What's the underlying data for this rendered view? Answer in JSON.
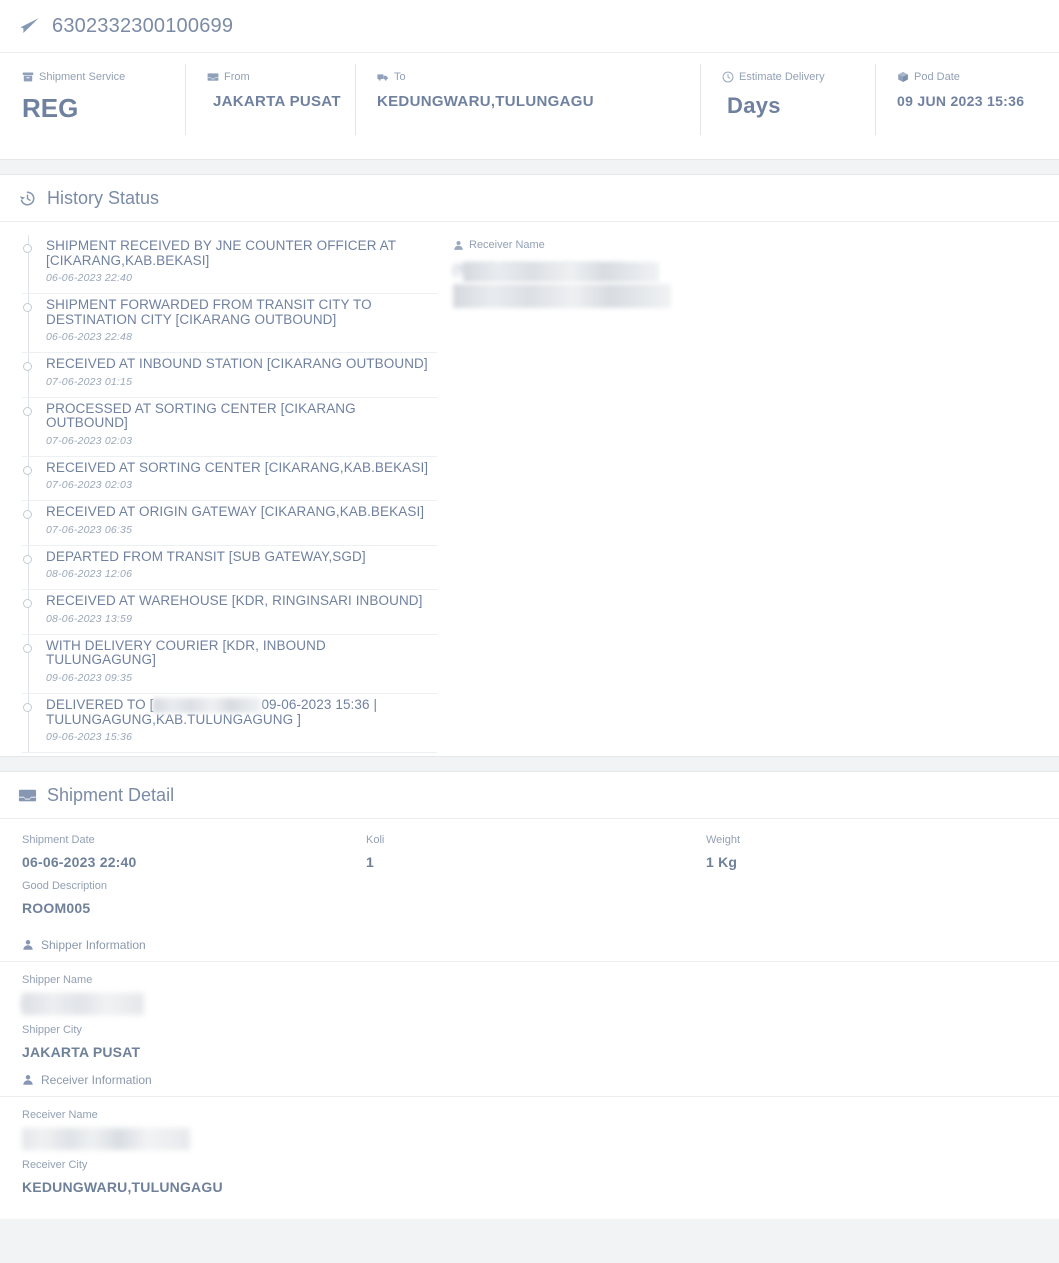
{
  "header": {
    "awb_number": "6302332300100699",
    "plane_icon": "paper-plane-icon",
    "fields": [
      {
        "key": "service",
        "icon": "archive-box-icon",
        "label": "Shipment Service",
        "value": "REG"
      },
      {
        "key": "from",
        "icon": "inbox-tray-icon",
        "label": "From",
        "value": "JAKARTA  PUSAT"
      },
      {
        "key": "to",
        "icon": "truck-icon",
        "label": "To",
        "value": "KEDUNGWARU,TULUNGAGU"
      },
      {
        "key": "eta",
        "icon": "clock-icon",
        "label": "Estimate Delivery",
        "value": "Days"
      },
      {
        "key": "pod",
        "icon": "cube-icon",
        "label": "Pod Date",
        "value": "09 JUN 2023  15:36"
      }
    ]
  },
  "history": {
    "icon": "history-clock-icon",
    "title": "History Status",
    "items": [
      {
        "text": "SHIPMENT RECEIVED BY JNE COUNTER OFFICER AT [CIKARANG,KAB.BEKASI]",
        "time": "06-06-2023 22:40"
      },
      {
        "text": "SHIPMENT FORWARDED FROM TRANSIT CITY TO DESTINATION CITY [CIKARANG OUTBOUND]",
        "time": "06-06-2023 22:48"
      },
      {
        "text": "RECEIVED AT INBOUND STATION [CIKARANG OUTBOUND]",
        "time": "07-06-2023 01:15"
      },
      {
        "text": "PROCESSED AT SORTING CENTER [CIKARANG OUTBOUND]",
        "time": "07-06-2023 02:03"
      },
      {
        "text": "RECEIVED AT SORTING CENTER [CIKARANG,KAB.BEKASI]",
        "time": "07-06-2023 02:03"
      },
      {
        "text": "RECEIVED AT ORIGIN GATEWAY [CIKARANG,KAB.BEKASI]",
        "time": "07-06-2023 06:35"
      },
      {
        "text": "DEPARTED FROM TRANSIT [SUB GATEWAY,SGD]",
        "time": "08-06-2023 12:06"
      },
      {
        "text": "RECEIVED AT WAREHOUSE [KDR, RINGINSARI INBOUND]",
        "time": "08-06-2023 13:59"
      },
      {
        "text": "WITH DELIVERY COURIER [KDR, INBOUND TULUNGAGUNG]",
        "time": "09-06-2023 09:35"
      }
    ],
    "delivered": {
      "prefix": "DELIVERED TO [",
      "redacted": true,
      "suffix": "09-06-2023 15:36 | TULUNGAGUNG,KAB.TULUNGAGUNG ]",
      "time": "09-06-2023 15:36"
    },
    "receiver_panel": {
      "icon": "person-icon",
      "label": "Receiver Name",
      "value_redacted": true,
      "value_partial": "(YANG BERSANGKUTAN)"
    }
  },
  "detail": {
    "icon": "inbox-tray-icon",
    "title": "Shipment Detail",
    "fields": {
      "shipment_date_label": "Shipment Date",
      "shipment_date_value": "06-06-2023 22:40",
      "koli_label": "Koli",
      "koli_value": "1",
      "weight_label": "Weight",
      "weight_value": "1 Kg",
      "good_description_label": "Good Description",
      "good_description_value": "ROOM005"
    },
    "shipper": {
      "icon": "person-icon",
      "title": "Shipper Information",
      "name_label": "Shipper Name",
      "name_value": "RB INDONESIA",
      "name_redacted": true,
      "city_label": "Shipper City",
      "city_value": "JAKARTA PUSAT"
    },
    "receiver": {
      "icon": "person-icon",
      "title": "Receiver Information",
      "name_label": "Receiver Name",
      "name_value": "",
      "name_redacted": true,
      "city_label": "Receiver City",
      "city_value": "KEDUNGWARU,TULUNGAGU"
    }
  },
  "colors": {
    "text_primary": "#7081a0",
    "text_muted": "#93a0b4",
    "heading": "#7b8ba6",
    "border": "#e4e7ea",
    "page_bg": "#f2f3f5",
    "card_bg": "#ffffff"
  }
}
